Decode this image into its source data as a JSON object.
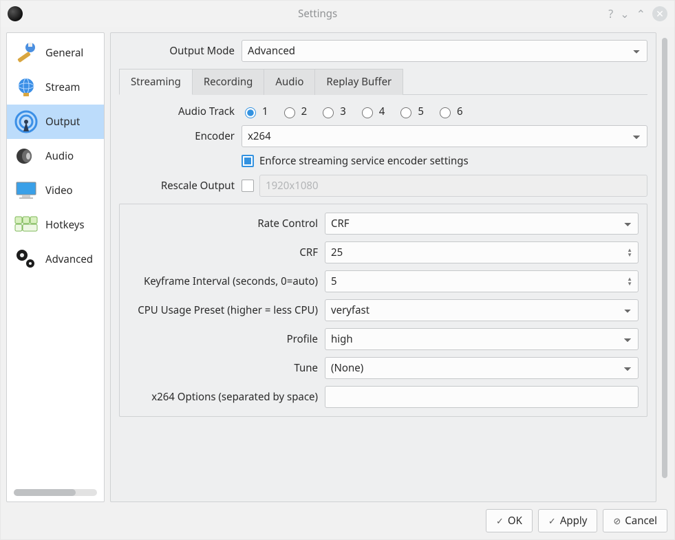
{
  "window": {
    "title": "Settings"
  },
  "sidebar": {
    "items": [
      {
        "label": "General"
      },
      {
        "label": "Stream"
      },
      {
        "label": "Output"
      },
      {
        "label": "Audio"
      },
      {
        "label": "Video"
      },
      {
        "label": "Hotkeys"
      },
      {
        "label": "Advanced"
      }
    ]
  },
  "output_mode": {
    "label": "Output Mode",
    "value": "Advanced"
  },
  "tabs": [
    {
      "label": "Streaming"
    },
    {
      "label": "Recording"
    },
    {
      "label": "Audio"
    },
    {
      "label": "Replay Buffer"
    }
  ],
  "streaming": {
    "audio_track_label": "Audio Track",
    "audio_tracks": [
      "1",
      "2",
      "3",
      "4",
      "5",
      "6"
    ],
    "audio_track_selected": "1",
    "encoder_label": "Encoder",
    "encoder_value": "x264",
    "enforce_label": "Enforce streaming service encoder settings",
    "rescale_label": "Rescale Output",
    "rescale_value": "1920x1080",
    "encoder_opts": {
      "rate_control_label": "Rate Control",
      "rate_control_value": "CRF",
      "crf_label": "CRF",
      "crf_value": "25",
      "keyint_label": "Keyframe Interval (seconds, 0=auto)",
      "keyint_value": "5",
      "preset_label": "CPU Usage Preset (higher = less CPU)",
      "preset_value": "veryfast",
      "profile_label": "Profile",
      "profile_value": "high",
      "tune_label": "Tune",
      "tune_value": "(None)",
      "x264opts_label": "x264 Options (separated by space)",
      "x264opts_value": ""
    }
  },
  "buttons": {
    "ok": "OK",
    "apply": "Apply",
    "cancel": "Cancel"
  }
}
